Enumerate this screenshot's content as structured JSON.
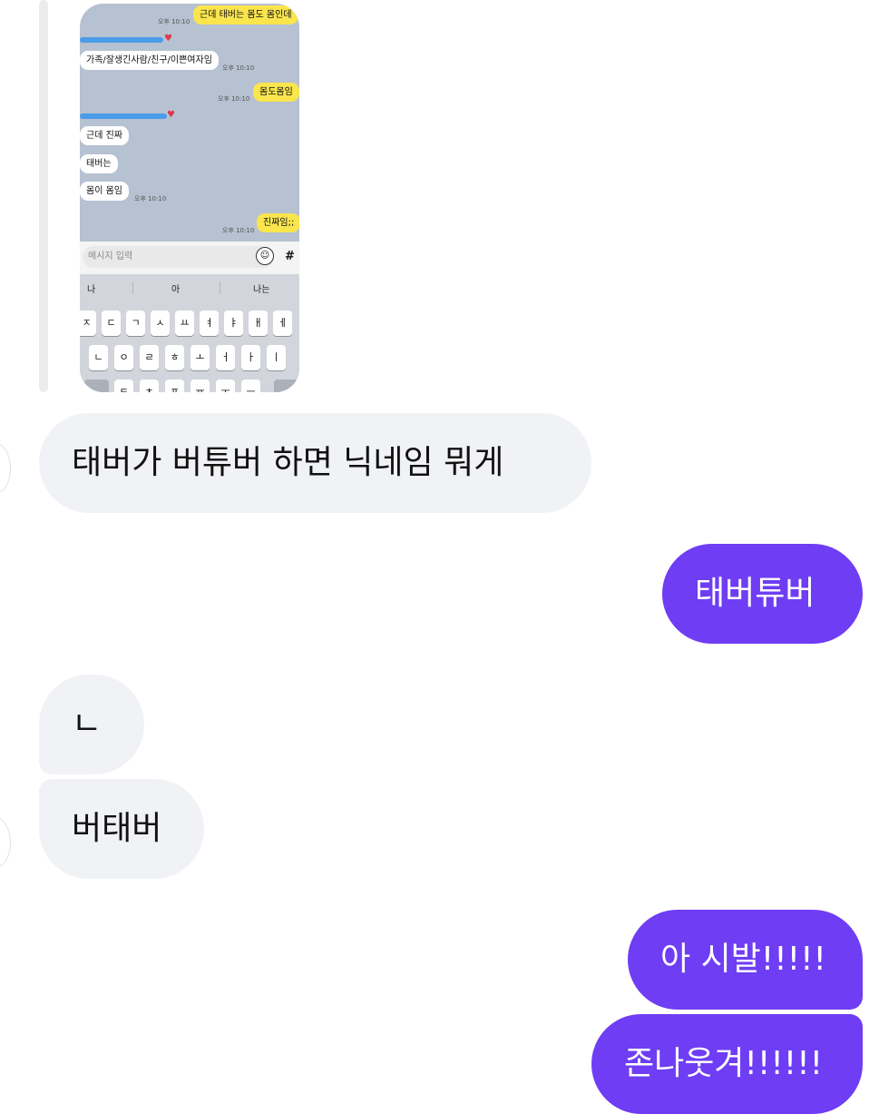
{
  "screenshot": {
    "messages": [
      {
        "text": "근데 태버는 몸도 몸인데"
      },
      {
        "text": "가족/잘생긴사람/친구/이쁜여자임"
      },
      {
        "text": "몸도몸임"
      },
      {
        "text": "근데 진짜"
      },
      {
        "text": "태버는"
      },
      {
        "text": "몸이 몸임"
      },
      {
        "text": "진짜임;;"
      }
    ],
    "time_label": "오후 10:10",
    "input_placeholder": "메시지 입력",
    "hash_label": "#",
    "suggestions": [
      "나",
      "아",
      "나는"
    ],
    "keyboard_row1": [
      "ㅈ",
      "ㄷ",
      "ㄱ",
      "ㅅ",
      "ㅛ",
      "ㅕ",
      "ㅑ",
      "ㅐ",
      "ㅔ"
    ],
    "keyboard_row2": [
      "ㄴ",
      "ㅇ",
      "ㄹ",
      "ㅎ",
      "ㅗ",
      "ㅓ",
      "ㅏ",
      "ㅣ"
    ],
    "keyboard_row3": [
      "ㅌ",
      "ㅊ",
      "ㅍ",
      "ㅠ",
      "ㅜ",
      "ㅡ"
    ]
  },
  "chat": {
    "messages": [
      {
        "sender": "them",
        "text": "태버가 버튜버 하면 닉네임 뭐게"
      },
      {
        "sender": "me",
        "text": "태버튜버"
      },
      {
        "sender": "them",
        "text": "ㄴ"
      },
      {
        "sender": "them",
        "text": "버태버"
      },
      {
        "sender": "me",
        "text": "아 시발!!!!!"
      },
      {
        "sender": "me",
        "text": "존나웃겨!!!!!!"
      }
    ]
  },
  "colors": {
    "outgoing_bubble": "#6e3df4",
    "incoming_bubble": "#f1f2f5",
    "kakao_yellow": "#fae54d",
    "kakao_background": "#b6c1d1"
  }
}
